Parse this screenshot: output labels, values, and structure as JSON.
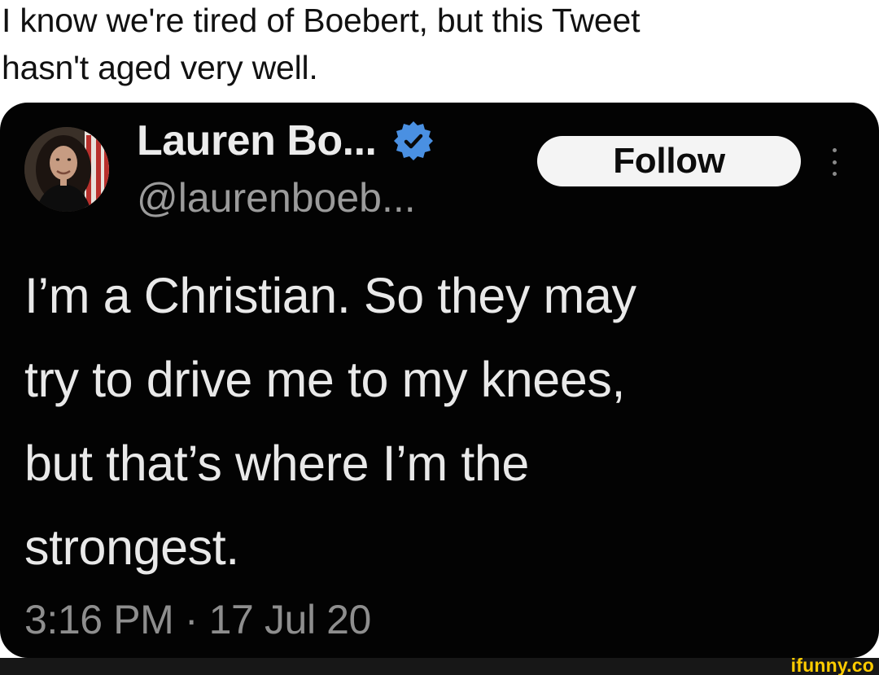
{
  "caption": {
    "line1": "I know we're tired of Boebert, but this Tweet",
    "line2": "hasn't aged very well."
  },
  "tweet": {
    "author_name": "Lauren Bo...",
    "author_handle": "@laurenboeb...",
    "verified_icon": "verified-badge-icon",
    "follow_label": "Follow",
    "more_icon": "more-vertical-icon",
    "text": "I’m a Christian. So they may\ntry to drive me to my knees,\nbut that’s where I’m the\nstrongest.",
    "timestamp": "3:16 PM · 17 Jul 20"
  },
  "watermark": {
    "text": "ifunny.co"
  },
  "colors": {
    "card_background": "#030303",
    "verified_blue": "#4a90e2",
    "watermark_yellow": "#ffcc00"
  }
}
